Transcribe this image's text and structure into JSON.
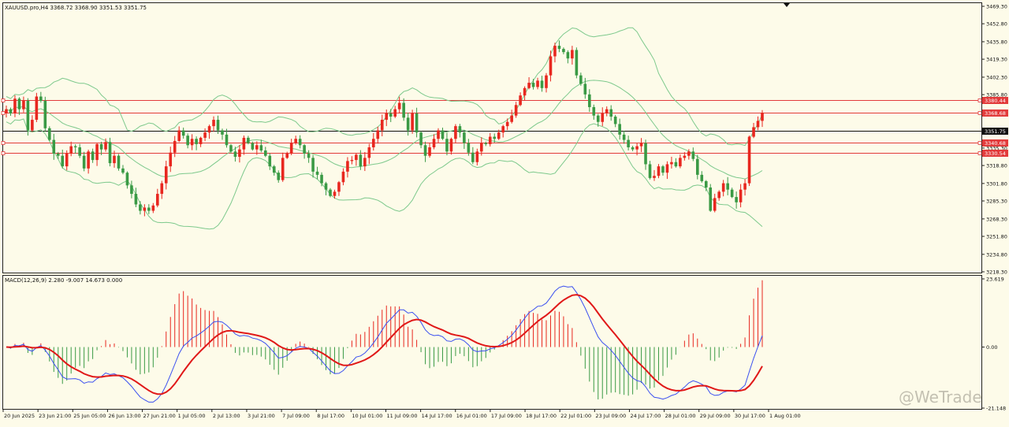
{
  "header": {
    "symbol_info": "XAUUSD.pro,H4  3368.72 3368.90 3351.53 3351.75",
    "macd_info": "MACD(12,26,9) 2.280 -9.007 14.673 0.000"
  },
  "watermark": "@WeTrade",
  "colors": {
    "background": "#fdfbe9",
    "bull": "#e8271f",
    "bear": "#3a9a45",
    "bands": "#7dc98c",
    "hline": "#e23a3a",
    "macd_line": "#3a4ff0",
    "signal_line": "#e01818",
    "hist_pos": "#e8271f",
    "hist_neg": "#3a9a45",
    "tag_red": "#e23a3a",
    "tag_dark": "#111111"
  },
  "chart_data": [
    {
      "type": "candlestick",
      "symbol": "XAUUSD.pro",
      "timeframe": "H4",
      "ylim": [
        3218.3,
        3469.3
      ],
      "y_ticks": [
        "3469.30",
        "3452.80",
        "3435.80",
        "3419.30",
        "3402.30",
        "3385.80",
        "3368.80",
        "3352.30",
        "3335.30",
        "3318.80",
        "3301.80",
        "3285.30",
        "3268.30",
        "3251.80",
        "3234.80",
        "3218.30"
      ],
      "x_labels": [
        "20 Jun 2025",
        "23 Jun 21:00",
        "25 Jun 05:00",
        "26 Jun 13:00",
        "27 Jun 21:00",
        "1 Jul 05:00",
        "2 Jul 13:00",
        "3 Jul 21:00",
        "7 Jul 09:00",
        "8 Jul 17:00",
        "10 Jul 01:00",
        "11 Jul 09:00",
        "14 Jul 17:00",
        "16 Jul 01:00",
        "17 Jul 09:00",
        "18 Jul 17:00",
        "22 Jul 01:00",
        "23 Jul 09:00",
        "24 Jul 17:00",
        "28 Jul 01:00",
        "29 Jul 09:00",
        "30 Jul 17:00",
        "1 Aug 01:00"
      ],
      "horizontal_lines": [
        {
          "value": 3380.44,
          "label": "3380.44",
          "style": "red"
        },
        {
          "value": 3368.68,
          "label": "3368.68",
          "style": "red"
        },
        {
          "value": 3351.75,
          "label": "3351.75",
          "style": "dark"
        },
        {
          "value": 3340.68,
          "label": "3340.68",
          "style": "red"
        },
        {
          "value": 3330.54,
          "label": "3330.54",
          "style": "red"
        }
      ],
      "close": [
        3372,
        3368,
        3382,
        3372,
        3380,
        3352,
        3362,
        3384,
        3380,
        3354,
        3343,
        3330,
        3328,
        3318,
        3330,
        3337,
        3336,
        3328,
        3316,
        3332,
        3324,
        3339,
        3334,
        3341,
        3321,
        3328,
        3316,
        3312,
        3300,
        3292,
        3282,
        3276,
        3279,
        3276,
        3281,
        3292,
        3302,
        3318,
        3331,
        3342,
        3352,
        3347,
        3338,
        3344,
        3339,
        3345,
        3350,
        3356,
        3362,
        3352,
        3348,
        3338,
        3332,
        3327,
        3334,
        3345,
        3340,
        3334,
        3338,
        3333,
        3328,
        3318,
        3312,
        3305,
        3326,
        3330,
        3340,
        3344,
        3338,
        3330,
        3326,
        3313,
        3310,
        3302,
        3296,
        3290,
        3294,
        3303,
        3313,
        3323,
        3324,
        3329,
        3318,
        3326,
        3336,
        3344,
        3352,
        3362,
        3368,
        3365,
        3372,
        3378,
        3364,
        3352,
        3368,
        3350,
        3338,
        3328,
        3336,
        3344,
        3352,
        3344,
        3332,
        3344,
        3356,
        3350,
        3340,
        3331,
        3322,
        3332,
        3340,
        3339,
        3346,
        3344,
        3350,
        3356,
        3360,
        3366,
        3376,
        3385,
        3392,
        3397,
        3393,
        3399,
        3392,
        3404,
        3422,
        3432,
        3429,
        3426,
        3420,
        3428,
        3404,
        3396,
        3386,
        3374,
        3366,
        3360,
        3368,
        3372,
        3365,
        3358,
        3348,
        3343,
        3336,
        3334,
        3337,
        3340,
        3320,
        3307,
        3309,
        3318,
        3312,
        3320,
        3322,
        3318,
        3326,
        3328,
        3332,
        3325,
        3310,
        3304,
        3298,
        3276,
        3288,
        3294,
        3302,
        3296,
        3289,
        3284,
        3296,
        3302,
        3346,
        3355,
        3361,
        3368.72
      ]
    },
    {
      "type": "line",
      "title": "MACD(12,26,9)",
      "values_shown": {
        "macd": 2.28,
        "signal": -9.007,
        "histogram": 14.673,
        "zero": 0.0
      },
      "y_ticks": [
        "23.619",
        "0.00",
        "-21.148"
      ],
      "ylim": [
        -21.148,
        23.619
      ]
    }
  ]
}
